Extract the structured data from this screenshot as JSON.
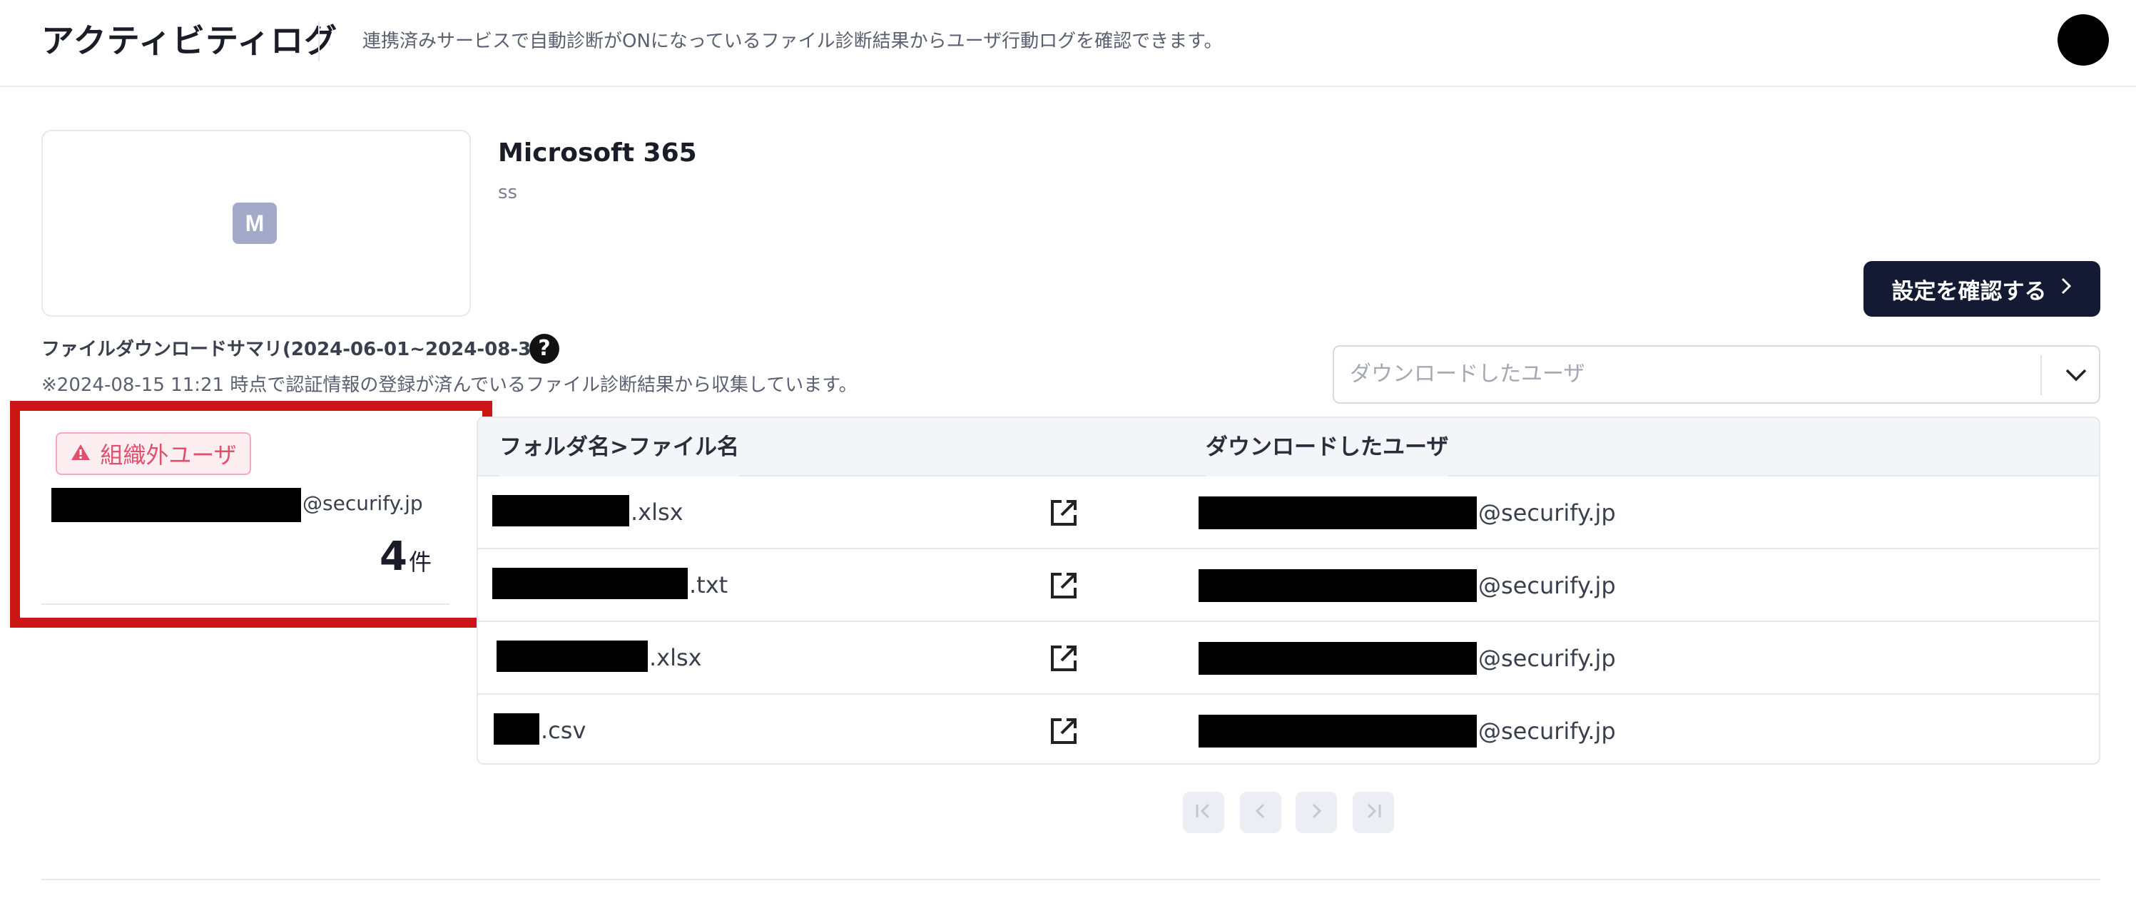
{
  "header": {
    "title": "アクティビティログ",
    "description": "連携済みサービスで自動診断がONになっているファイル診断結果からユーザ行動ログを確認できます。"
  },
  "service": {
    "logo_letter": "M",
    "name": "Microsoft 365",
    "sub": "ss",
    "settings_label": "設定を確認する"
  },
  "summary": {
    "title": "ファイルダウンロードサマリ(2024-06-01~2024-08-31)",
    "note": "※2024-08-15 11:21 時点で認証情報の登録が済んでいるファイル診断結果から収集しています。"
  },
  "user_select": {
    "placeholder": "ダウンロードしたユーザ"
  },
  "user_summary": {
    "badge": "組織外ユーザ",
    "domain": "@securify.jp",
    "count": "4",
    "count_unit": "件"
  },
  "table": {
    "headers": {
      "file": "フォルダ名>ファイル名",
      "user": "ダウンロードしたユーザ"
    },
    "rows": [
      {
        "ext": ".xlsx",
        "domain": "@securify.jp"
      },
      {
        "ext": ".txt",
        "domain": "@securify.jp"
      },
      {
        "ext": ".xlsx",
        "domain": "@securify.jp"
      },
      {
        "ext": ".csv",
        "domain": "@securify.jp"
      }
    ]
  },
  "colors": {
    "primary_button": "#141a33",
    "badge_text": "#e0506e",
    "badge_bg": "#fdeef2",
    "highlight": "#cc1616"
  }
}
